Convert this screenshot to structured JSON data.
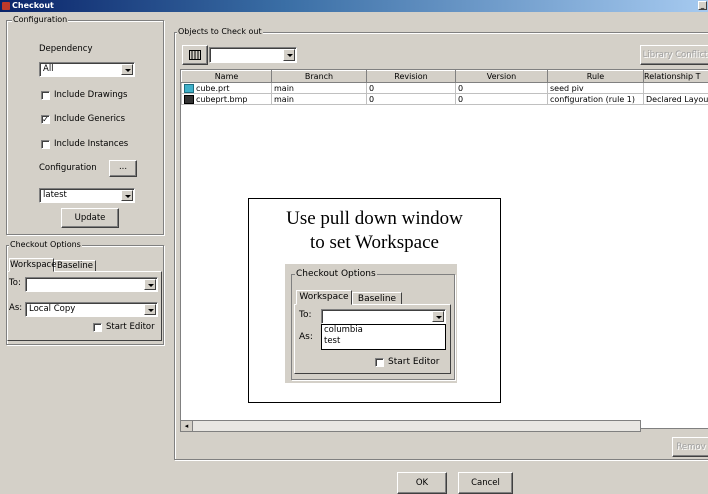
{
  "window": {
    "title": "Checkout"
  },
  "configuration": {
    "legend": "Configuration",
    "dependency_label": "Dependency",
    "dependency_value": "All",
    "include_drawings": {
      "label": "Include Drawings",
      "checked": false
    },
    "include_generics": {
      "label": "Include Generics",
      "checked": true
    },
    "include_instances": {
      "label": "Include Instances",
      "checked": false
    },
    "configuration_label": "Configuration",
    "configuration_button": "...",
    "configuration_value": "latest",
    "update_button": "Update"
  },
  "checkout_options": {
    "legend": "Checkout Options",
    "tabs": [
      "Workspace",
      "Baseline"
    ],
    "to_label": "To:",
    "to_value": "",
    "as_label": "As:",
    "as_value": "Local Copy",
    "start_editor": {
      "label": "Start Editor",
      "checked": false
    }
  },
  "objects": {
    "legend": "Objects to Check out",
    "filter_value": "",
    "library_button": "Library Conflict",
    "columns": [
      "Name",
      "Branch",
      "Revision",
      "Version",
      "Rule",
      "Relationship T"
    ],
    "rows": [
      {
        "icon": "part-icon",
        "name": "cube.prt",
        "branch": "main",
        "revision": "0",
        "version": "0",
        "rule": "seed piv",
        "relationship": ""
      },
      {
        "icon": "image-icon",
        "name": "cubeprt.bmp",
        "branch": "main",
        "revision": "0",
        "version": "0",
        "rule": "configuration (rule 1)",
        "relationship": "Declared Layout"
      }
    ],
    "remove_button": "Remov"
  },
  "callout": {
    "line1": "Use pull down window",
    "line2": "to set Workspace",
    "inset": {
      "legend": "Checkout Options",
      "tabs": [
        "Workspace",
        "Baseline"
      ],
      "to_label": "To:",
      "as_label": "As:",
      "options": [
        "columbia",
        "test"
      ],
      "start_editor_label": "Start Editor"
    }
  },
  "footer": {
    "ok_button": "OK",
    "cancel_button": "Cancel"
  }
}
